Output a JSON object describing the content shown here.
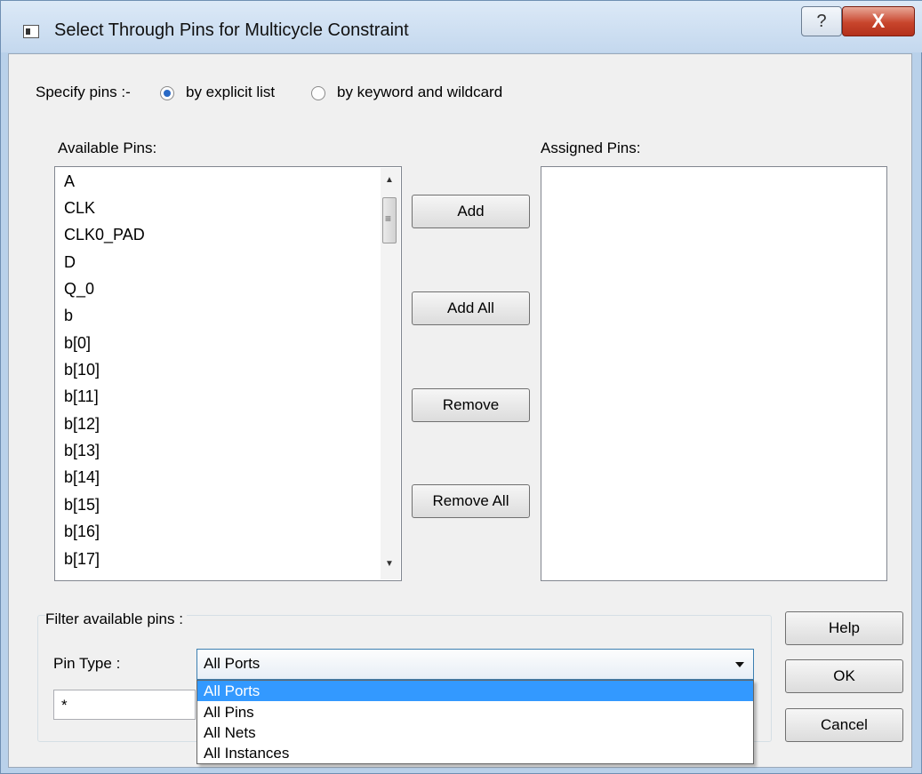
{
  "window": {
    "title": "Select Through Pins for Multicycle Constraint",
    "help_glyph": "?",
    "close_glyph": "X"
  },
  "specify": {
    "label": "Specify pins :-",
    "options": [
      {
        "label": "by explicit list",
        "selected": true
      },
      {
        "label": "by keyword and wildcard",
        "selected": false
      }
    ]
  },
  "available": {
    "label": "Available Pins:",
    "items": [
      "A",
      "CLK",
      "CLK0_PAD",
      "D",
      "Q_0",
      "b",
      "b[0]",
      "b[10]",
      "b[11]",
      "b[12]",
      "b[13]",
      "b[14]",
      "b[15]",
      "b[16]",
      "b[17]"
    ],
    "scroll_up_glyph": "▲",
    "scroll_down_glyph": "▼",
    "grip_glyph": "≡"
  },
  "assigned": {
    "label": "Assigned Pins:",
    "items": []
  },
  "actions": {
    "add": "Add",
    "add_all": "Add All",
    "remove": "Remove",
    "remove_all": "Remove All"
  },
  "filter": {
    "group_label": "Filter available pins :",
    "pin_type_label": "Pin Type :",
    "pin_type_value": "All Ports",
    "text_value": "*",
    "options": [
      "All Ports",
      "All Pins",
      "All Nets",
      "All Instances"
    ],
    "highlighted": "All Ports"
  },
  "dialog_buttons": {
    "help": "Help",
    "ok": "OK",
    "cancel": "Cancel"
  },
  "colors": {
    "selection": "#3399ff",
    "radio_dot": "#2a6ac6",
    "close_button": "#c8452c"
  }
}
